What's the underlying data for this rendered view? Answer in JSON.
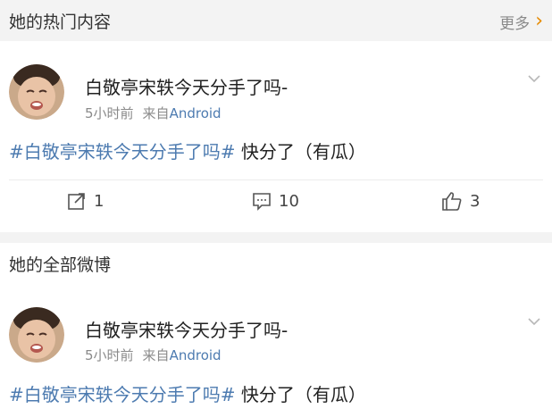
{
  "hot_section": {
    "title": "她的热门内容",
    "more_label": "更多"
  },
  "all_section": {
    "title": "她的全部微博"
  },
  "posts": [
    {
      "author": "白敬亭宋轶今天分手了吗-",
      "time": "5小时前",
      "source_prefix": "来自",
      "source": "Android",
      "topic": "#白敬亭宋轶今天分手了吗#",
      "text": " 快分了（有瓜）",
      "reposts": "1",
      "comments": "10",
      "likes": "3"
    },
    {
      "author": "白敬亭宋轶今天分手了吗-",
      "time": "5小时前",
      "source_prefix": "来自",
      "source": "Android",
      "topic": "#白敬亭宋轶今天分手了吗#",
      "text": " 快分了（有瓜）"
    }
  ],
  "colors": {
    "link": "#4d7bb0",
    "more_chevron": "#e68a00",
    "section_bg": "#f3f3f3"
  }
}
